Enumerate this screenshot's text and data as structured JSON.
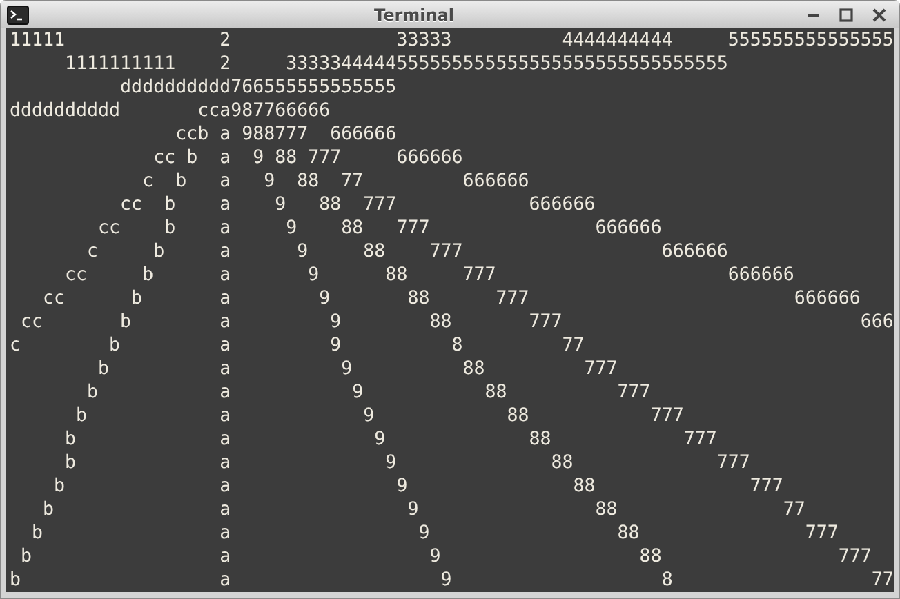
{
  "window": {
    "title": "Terminal"
  },
  "lines": [
    "11111              2               33333          4444444444     555555555555555",
    "     1111111111    2     3333344444555555555555555555555555555555",
    "          dddddddddd766555555555555",
    "dddddddddd       cca987766666",
    "               ccb a 988777  666666",
    "             cc b  a  9 88 777     666666",
    "            c  b   a   9  88  77         666666",
    "          cc  b    a    9   88  777            666666",
    "        cc    b    a     9    88   777               666666",
    "       c     b     a      9     88    777                  666666",
    "     cc     b      a       9      88     777                     666666",
    "   cc      b       a        9       88      777                        666666",
    " cc       b        a         9        88       777                           666",
    "c        b         a         9          8         77",
    "        b          a          9          88         777",
    "       b           a           9           88          777",
    "      b            a            9            88           777",
    "     b             a             9             88            777",
    "     b             a              9              88             777",
    "    b              a               9               88              777",
    "   b               a                9                88               77",
    "  b                a                 9                 88               777",
    " b                 a                  9                  88                777",
    "b                  a                   9                   8                  77"
  ]
}
